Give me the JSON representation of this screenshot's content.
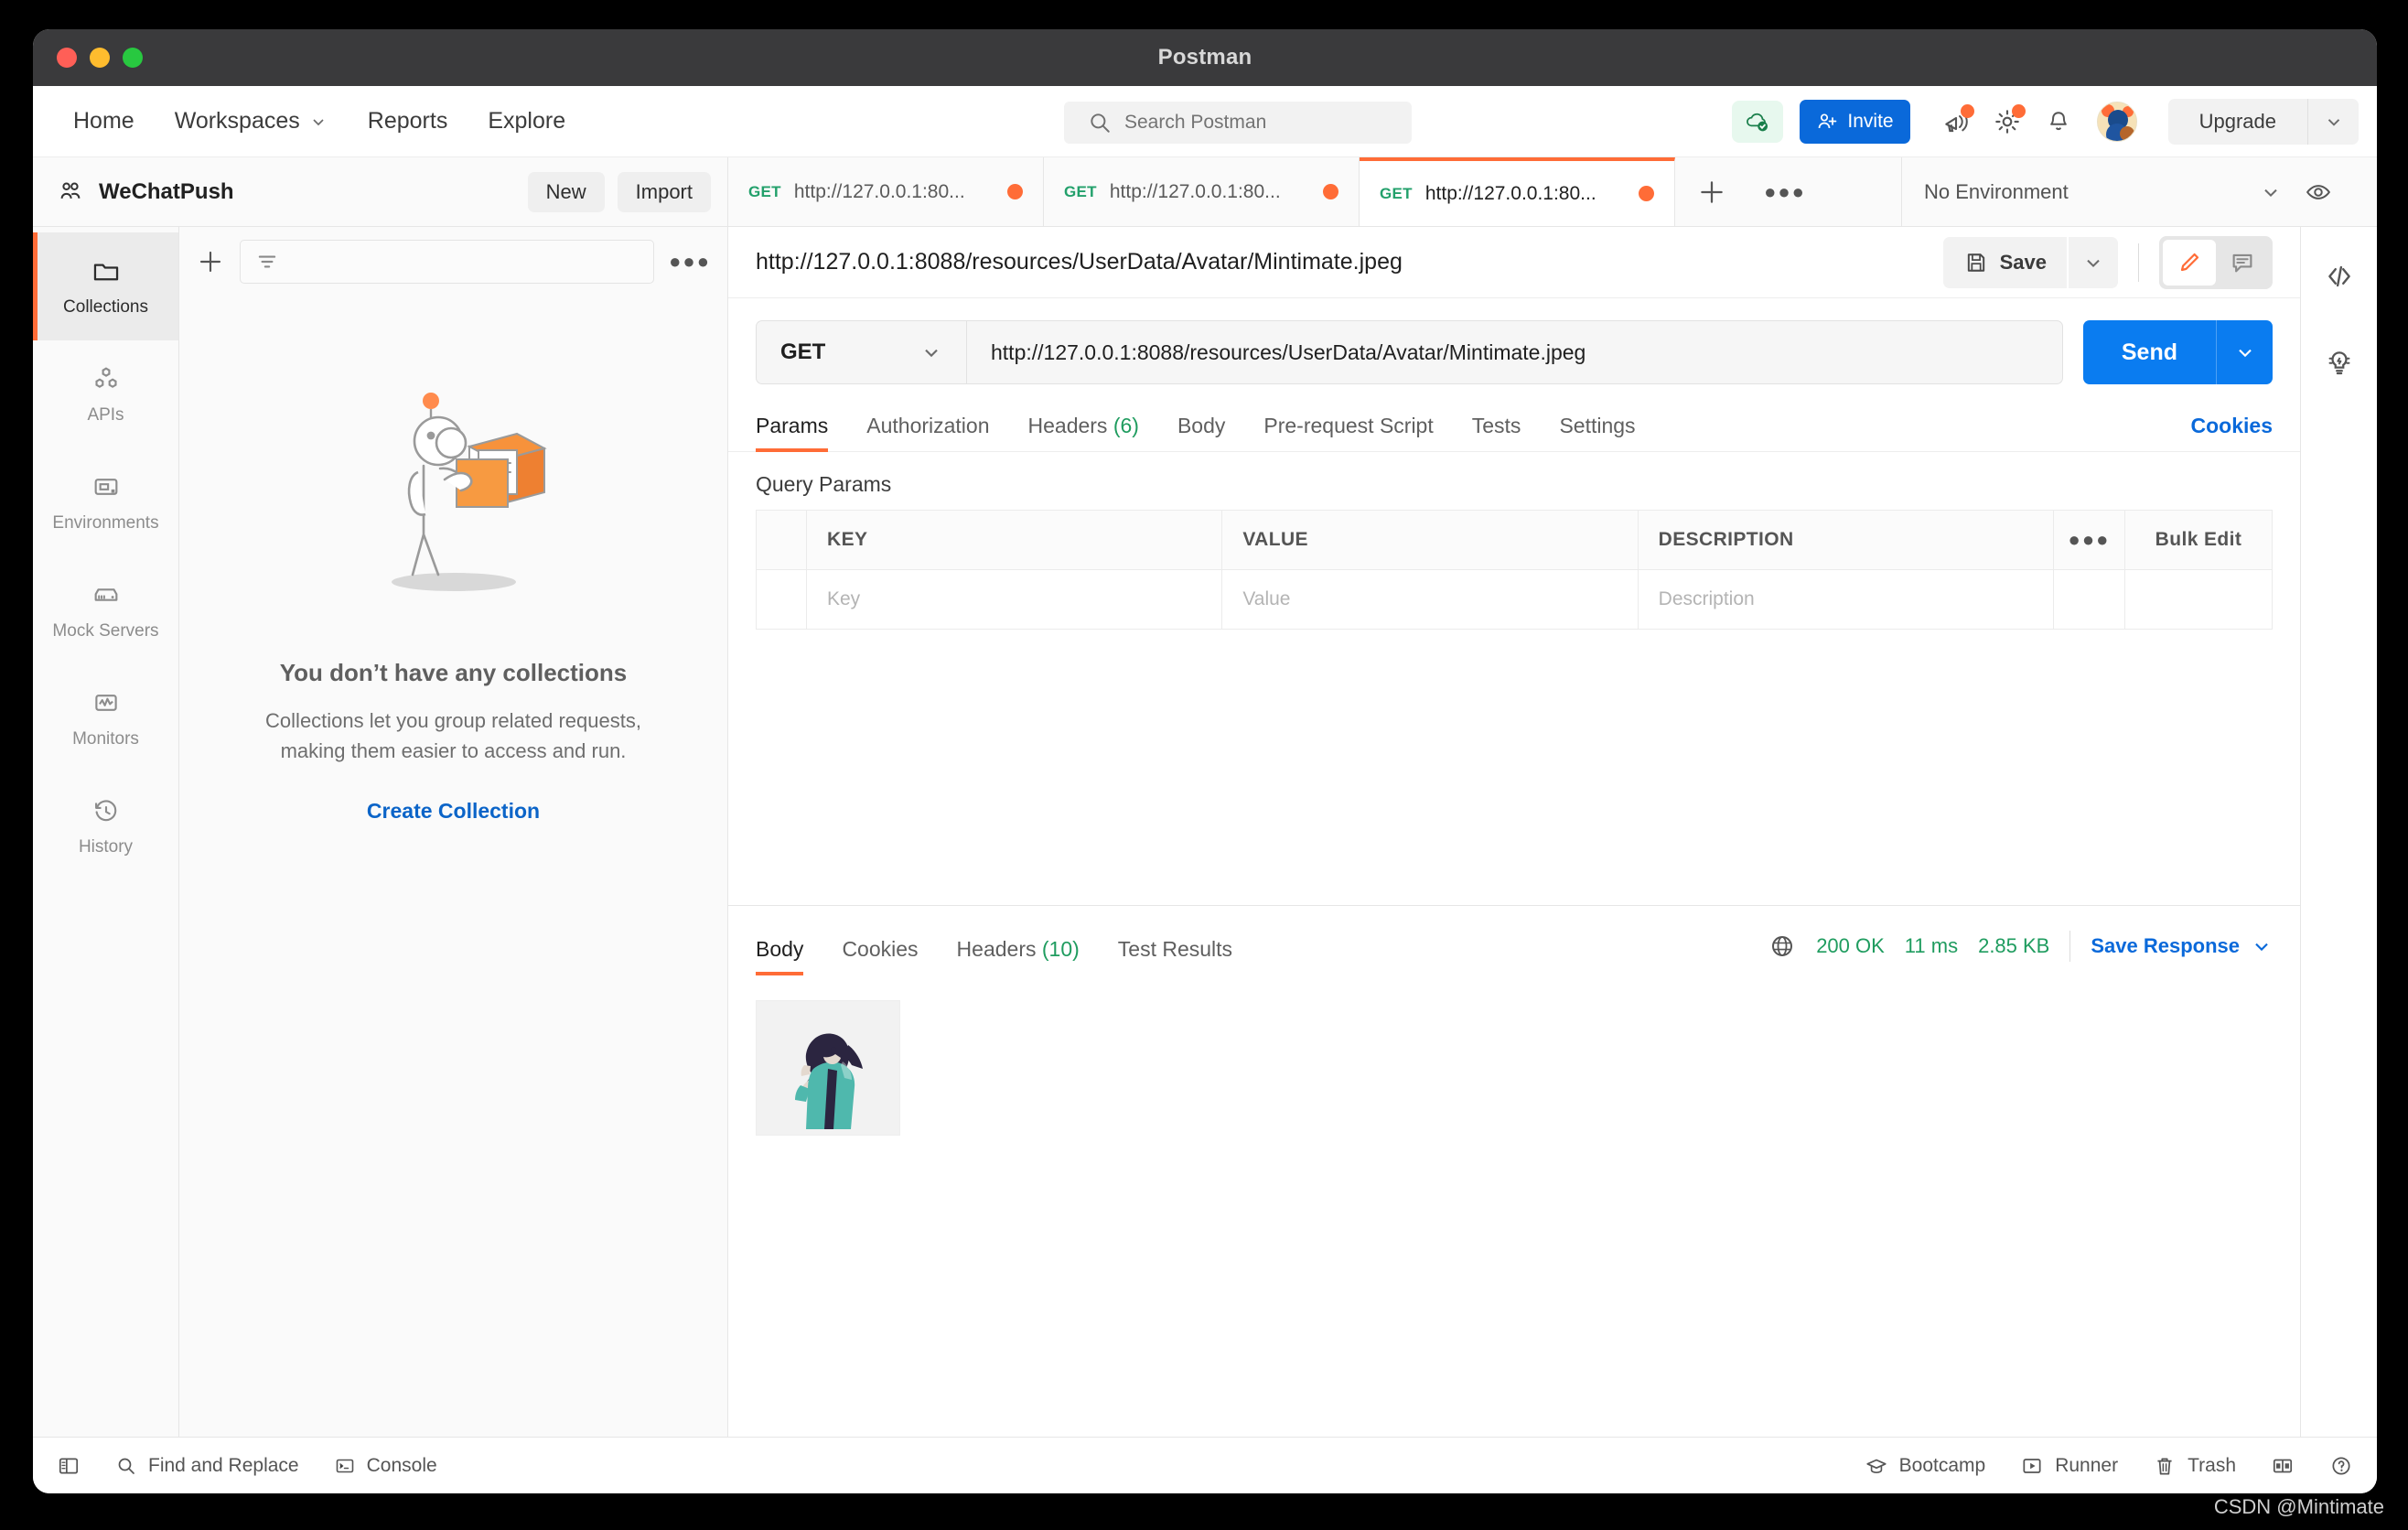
{
  "window": {
    "title": "Postman"
  },
  "topnav": {
    "links": [
      {
        "label": "Home",
        "caret": false
      },
      {
        "label": "Workspaces",
        "caret": true
      },
      {
        "label": "Reports",
        "caret": false
      },
      {
        "label": "Explore",
        "caret": false
      }
    ],
    "search_placeholder": "Search Postman",
    "invite_label": "Invite",
    "upgrade_label": "Upgrade",
    "icons": {
      "cloud": "cloud-check-icon",
      "invite": "person-add-icon",
      "announcement": "megaphone-icon",
      "settings": "gear-icon",
      "notifications": "bell-icon",
      "avatar": "user-avatar",
      "upgrade_caret": "chevron-down-icon"
    }
  },
  "workspace": {
    "name": "WeChatPush",
    "new_label": "New",
    "import_label": "Import"
  },
  "tabs": [
    {
      "method": "GET",
      "name": "http://127.0.0.1:80...",
      "unsaved": true,
      "active": false
    },
    {
      "method": "GET",
      "name": "http://127.0.0.1:80...",
      "unsaved": true,
      "active": false
    },
    {
      "method": "GET",
      "name": "http://127.0.0.1:80...",
      "unsaved": true,
      "active": true
    }
  ],
  "environment": {
    "selected": "No Environment"
  },
  "rail": [
    {
      "label": "Collections",
      "icon": "folder-icon",
      "active": true
    },
    {
      "label": "APIs",
      "icon": "apis-icon",
      "active": false
    },
    {
      "label": "Environments",
      "icon": "environments-icon",
      "active": false
    },
    {
      "label": "Mock Servers",
      "icon": "server-icon",
      "active": false
    },
    {
      "label": "Monitors",
      "icon": "monitor-icon",
      "active": false
    },
    {
      "label": "History",
      "icon": "history-icon",
      "active": false
    }
  ],
  "collections": {
    "filter_placeholder": "",
    "empty_title": "You don’t have any collections",
    "empty_sub": "Collections let you group related requests, making them easier to access and run.",
    "cta": "Create Collection"
  },
  "request": {
    "title": "http://127.0.0.1:8088/resources/UserData/Avatar/Mintimate.jpeg",
    "save_label": "Save",
    "method": "GET",
    "url": "http://127.0.0.1:8088/resources/UserData/Avatar/Mintimate.jpeg",
    "send_label": "Send",
    "tabs": [
      {
        "label": "Params",
        "count": "",
        "active": true
      },
      {
        "label": "Authorization",
        "count": "",
        "active": false
      },
      {
        "label": "Headers",
        "count": "(6)",
        "active": false
      },
      {
        "label": "Body",
        "count": "",
        "active": false
      },
      {
        "label": "Pre-request Script",
        "count": "",
        "active": false
      },
      {
        "label": "Tests",
        "count": "",
        "active": false
      },
      {
        "label": "Settings",
        "count": "",
        "active": false
      }
    ],
    "cookies_link": "Cookies",
    "query_params_label": "Query Params",
    "params_table": {
      "headers": [
        "KEY",
        "VALUE",
        "DESCRIPTION"
      ],
      "bulk_edit": "Bulk Edit",
      "placeholder_row": [
        "Key",
        "Value",
        "Description"
      ]
    }
  },
  "response": {
    "tabs": [
      {
        "label": "Body",
        "count": "",
        "active": true
      },
      {
        "label": "Cookies",
        "count": "",
        "active": false
      },
      {
        "label": "Headers",
        "count": "(10)",
        "active": false
      },
      {
        "label": "Test Results",
        "count": "",
        "active": false
      }
    ],
    "status": "200 OK",
    "time": "11 ms",
    "size": "2.85 KB",
    "save_response": "Save Response",
    "preview_alt": "image-preview-thumbnail"
  },
  "statusbar": {
    "left": [
      {
        "label": "",
        "icon": "sidebar-toggle-icon"
      },
      {
        "label": "Find and Replace",
        "icon": "search-icon"
      },
      {
        "label": "Console",
        "icon": "terminal-icon"
      }
    ],
    "right": [
      {
        "label": "Bootcamp",
        "icon": "graduation-cap-icon"
      },
      {
        "label": "Runner",
        "icon": "play-icon"
      },
      {
        "label": "Trash",
        "icon": "trash-icon"
      },
      {
        "label": "",
        "icon": "two-pane-icon"
      },
      {
        "label": "",
        "icon": "help-icon"
      }
    ]
  },
  "right_rail": [
    {
      "icon": "code-icon"
    },
    {
      "icon": "lightbulb-icon"
    }
  ],
  "watermark": "CSDN @Mintimate",
  "colors": {
    "accent_orange": "#ff6c37",
    "accent_blue": "#0a7cf0",
    "link_blue": "#0a69da",
    "status_green": "#1f9c5f",
    "method_green": "#22a06b",
    "titlebar": "#3a3a3c"
  }
}
